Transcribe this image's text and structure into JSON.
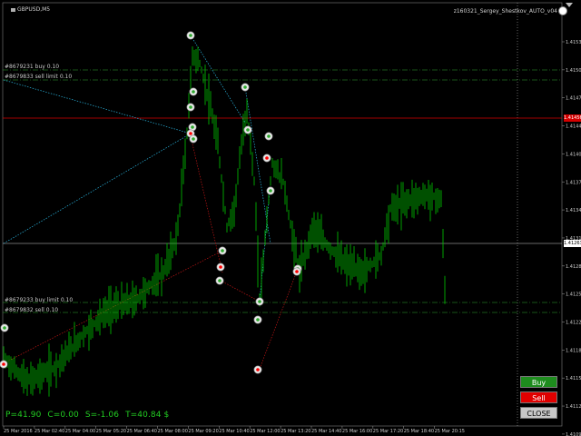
{
  "chart": {
    "symbol": "GBPUSD,M5",
    "ea_label": "z160321_Sergey_Shestkov_AUTO_v04",
    "price_ticks": [
      "1.41535",
      "1.41500",
      "1.41470",
      "1.41440",
      "1.41405",
      "1.41375",
      "1.41345",
      "1.41310",
      "1.41280",
      "1.41250",
      "1.41220",
      "1.41185",
      "1.41155",
      "1.41125",
      "1.41090"
    ],
    "current_price": "1.41456",
    "line_price": "1.41263",
    "time_ticks": [
      "25 Mar 2016",
      "25 Mar 02:40",
      "25 Mar 04:00",
      "25 Mar 05:20",
      "25 Mar 06:40",
      "25 Mar 08:00",
      "25 Mar 09:20",
      "25 Mar 10:40",
      "25 Mar 12:00",
      "25 Mar 13:20",
      "25 Mar 14:40",
      "25 Mar 16:00",
      "25 Mar 17:20",
      "25 Mar 18:40",
      "25 Mar 20:15"
    ]
  },
  "orders": [
    {
      "label": "#8679231 buy 0.10"
    },
    {
      "label": "#8679833 sell limit 0.10"
    },
    {
      "label": "#8679233 buy limit 0.10"
    },
    {
      "label": "#8679832 sell 0.10"
    }
  ],
  "status": {
    "p": "P=41.90",
    "c": "C=0.00",
    "s": "S=-1.06",
    "t": "T=40.84 $"
  },
  "buttons": {
    "buy": "Buy",
    "sell": "Sell",
    "close": "CLOSE"
  },
  "colors": {
    "candle": "#00c800",
    "current_line": "#d40000",
    "buy_color": "#2ea82e",
    "sell_color": "#ff0000"
  }
}
